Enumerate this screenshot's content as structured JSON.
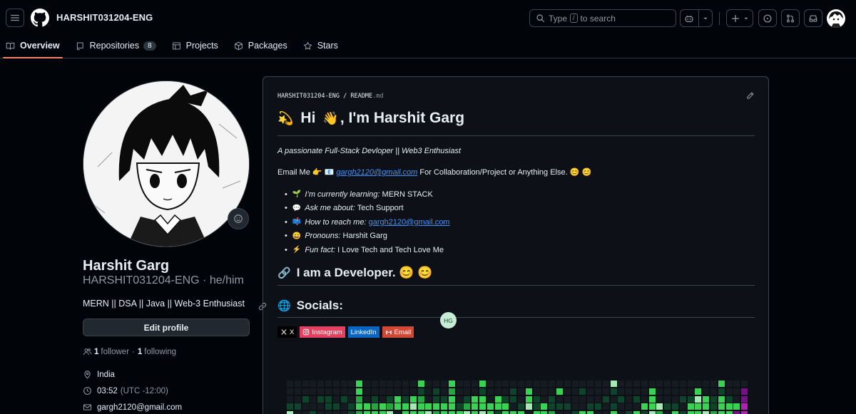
{
  "header": {
    "username": "HARSHIT031204-ENG",
    "search_placeholder_prefix": "Type",
    "search_key": "/",
    "search_placeholder_suffix": "to search"
  },
  "tabs": [
    {
      "label": "Overview",
      "icon": "book-icon",
      "active": true
    },
    {
      "label": "Repositories",
      "icon": "repo-icon",
      "count": "8"
    },
    {
      "label": "Projects",
      "icon": "table-icon"
    },
    {
      "label": "Packages",
      "icon": "package-icon"
    },
    {
      "label": "Stars",
      "icon": "star-icon"
    }
  ],
  "profile": {
    "name": "Harshit Garg",
    "login": "HARSHIT031204-ENG",
    "pronouns": "he/him",
    "bio": "MERN || DSA || Java || Web-3 Enthusiast",
    "edit_label": "Edit profile",
    "followers": "1",
    "followers_label": "follower",
    "following": "1",
    "following_label": "following",
    "location": "India",
    "time": "03:52",
    "timezone": "(UTC -12:00)",
    "email": "gargh2120@gmail.com"
  },
  "readme": {
    "path_user": "HARSHIT031204-ENG",
    "path_sep": "/",
    "path_file": "README",
    "path_ext": ".md",
    "title_emoji1": "💫",
    "title_hi": "Hi",
    "title_emoji2": "👋",
    "title_rest": ", I'm Harshit Garg",
    "tagline": "A passionate Full-Stack Devloper || Web3 Enthusiast",
    "email_prefix": "Email Me",
    "email_emoji": "👉 📧",
    "email": "gargh2120@gmail.com",
    "email_suffix": "For Collaboration/Project or Anything Else. 😊 😊",
    "facts": [
      {
        "emoji": "🌱",
        "label": "I’m currently learning:",
        "value": "MERN STACK"
      },
      {
        "emoji": "💬",
        "label": "Ask me about:",
        "value": "Tech Support"
      },
      {
        "emoji": "📫",
        "label": "How to reach me:",
        "value": "gargh2120@gmail.com",
        "link": true
      },
      {
        "emoji": "😄",
        "label": "Pronouns:",
        "value": "Harshit Garg"
      },
      {
        "emoji": "⚡",
        "label": "Fun fact:",
        "value": "I Love Tech and Tech Love Me"
      }
    ],
    "h2_dev_icon": "🔗",
    "h2_dev": "I am a Developer. 😊 😊",
    "h2_social_icon": "🌐",
    "h2_social": "Socials:",
    "hover_avatar": "HG",
    "badges": [
      {
        "label": "X",
        "icon": "x-logo-icon"
      },
      {
        "label": "Instagram",
        "icon": "instagram-icon"
      },
      {
        "label": "LinkedIn",
        "icon": ""
      },
      {
        "label": "Email",
        "icon": "gmail-icon"
      }
    ]
  },
  "colors": {
    "accent": "#f78166",
    "link": "#4493f8",
    "contrib_levels": [
      "#161b22",
      "#0e4429",
      "#006d32",
      "#26a641",
      "#39d353",
      "#a6e8b4",
      "#7a0e8a",
      "#b41fb6"
    ]
  },
  "contrib_columns": [
    [
      0,
      0,
      0,
      1,
      5
    ],
    [
      0,
      0,
      0,
      1,
      0
    ],
    [
      0,
      0,
      1,
      0,
      0
    ],
    [
      0,
      0,
      0,
      0,
      1
    ],
    [
      0,
      0,
      1,
      0,
      0
    ],
    [
      0,
      0,
      1,
      1,
      0
    ],
    [
      0,
      0,
      0,
      1,
      0
    ],
    [
      0,
      0,
      1,
      0,
      0
    ],
    [
      0,
      0,
      0,
      1,
      1
    ],
    [
      4,
      4,
      3,
      4,
      3
    ],
    [
      0,
      0,
      0,
      4,
      4
    ],
    [
      0,
      0,
      1,
      3,
      4
    ],
    [
      0,
      0,
      0,
      4,
      4
    ],
    [
      0,
      0,
      1,
      3,
      5
    ],
    [
      0,
      0,
      4,
      4,
      0
    ],
    [
      0,
      0,
      1,
      4,
      4
    ],
    [
      0,
      0,
      4,
      5,
      4
    ],
    [
      4,
      1,
      3,
      4,
      4
    ],
    [
      0,
      0,
      0,
      4,
      5
    ],
    [
      0,
      1,
      1,
      4,
      3
    ],
    [
      0,
      0,
      1,
      4,
      4
    ],
    [
      4,
      3,
      4,
      4,
      4
    ],
    [
      0,
      0,
      0,
      1,
      4
    ],
    [
      0,
      0,
      1,
      3,
      5
    ],
    [
      0,
      0,
      4,
      4,
      4
    ],
    [
      4,
      1,
      4,
      4,
      5
    ],
    [
      0,
      0,
      0,
      4,
      4
    ],
    [
      0,
      0,
      4,
      4,
      1
    ],
    [
      0,
      0,
      1,
      4,
      4
    ],
    [
      0,
      1,
      1,
      0,
      4
    ],
    [
      0,
      0,
      0,
      1,
      4
    ],
    [
      0,
      4,
      4,
      5,
      0
    ],
    [
      0,
      0,
      1,
      1,
      4
    ],
    [
      0,
      0,
      0,
      4,
      4
    ],
    [
      0,
      0,
      1,
      1,
      3
    ],
    [
      0,
      4,
      0,
      1,
      0
    ],
    [
      0,
      0,
      0,
      1,
      0
    ],
    [
      0,
      0,
      0,
      0,
      1
    ],
    [
      0,
      1,
      0,
      0,
      4
    ],
    [
      0,
      0,
      0,
      1,
      4
    ],
    [
      0,
      0,
      0,
      1,
      0
    ],
    [
      0,
      0,
      1,
      0,
      0
    ],
    [
      5,
      1,
      0,
      1,
      4
    ],
    [
      0,
      0,
      1,
      0,
      0
    ],
    [
      0,
      0,
      0,
      0,
      1
    ],
    [
      0,
      0,
      1,
      0,
      4
    ],
    [
      0,
      0,
      0,
      4,
      1
    ],
    [
      0,
      4,
      4,
      4,
      5
    ],
    [
      0,
      0,
      0,
      5,
      3
    ],
    [
      0,
      0,
      0,
      1,
      0
    ],
    [
      0,
      0,
      0,
      1,
      4
    ],
    [
      0,
      0,
      1,
      0,
      1
    ],
    [
      0,
      0,
      1,
      4,
      4
    ],
    [
      0,
      4,
      5,
      4,
      4
    ],
    [
      0,
      0,
      4,
      4,
      5
    ],
    [
      0,
      0,
      1,
      1,
      3
    ],
    [
      4,
      1,
      4,
      4,
      4
    ],
    [
      0,
      0,
      1,
      4,
      4
    ],
    [
      0,
      0,
      0,
      4,
      6
    ],
    [
      0,
      6,
      6,
      7,
      7
    ]
  ]
}
